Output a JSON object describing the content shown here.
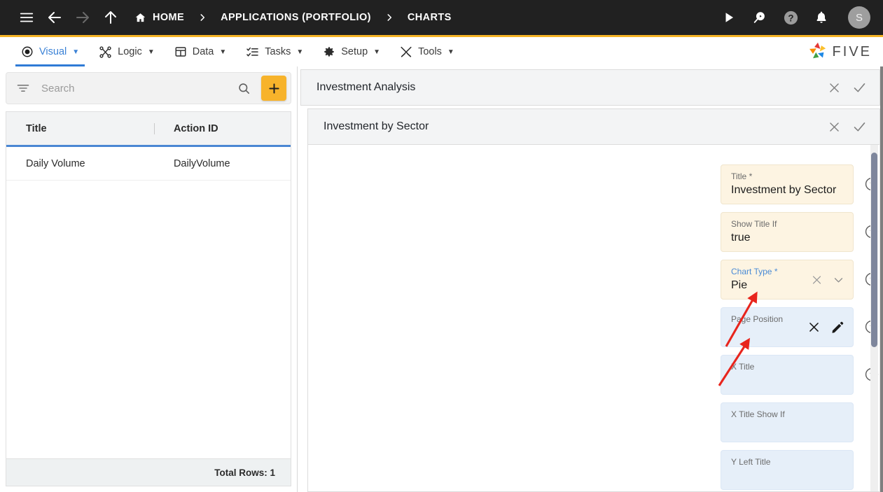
{
  "topbar": {
    "icons": [
      {
        "name": "hamburger-menu-icon",
        "label": "Menu"
      },
      {
        "name": "back-arrow-icon",
        "label": "Back"
      },
      {
        "name": "forward-arrow-icon",
        "label": "Forward"
      },
      {
        "name": "up-arrow-icon",
        "label": "Up"
      }
    ],
    "breadcrumbs": [
      {
        "label": "HOME",
        "icon": "home-icon"
      },
      {
        "label": "APPLICATIONS (PORTFOLIO)",
        "icon": ""
      },
      {
        "label": "CHARTS",
        "icon": ""
      }
    ],
    "separator": "›",
    "right_icons": [
      {
        "name": "play-icon",
        "label": "Run"
      },
      {
        "name": "search-play-icon",
        "label": "Search"
      },
      {
        "name": "help-circle-icon",
        "label": "Help"
      },
      {
        "name": "bell-icon",
        "label": "Notifications"
      }
    ],
    "avatar_initial": "S",
    "background": "#212121"
  },
  "menubar": {
    "accent_top": "#f5b324",
    "active_color": "#3b82d6",
    "caret": "▼",
    "items": [
      {
        "label": "Visual",
        "icon": "eye-icon",
        "active": true
      },
      {
        "label": "Logic",
        "icon": "logic-nodes-icon",
        "active": false
      },
      {
        "label": "Data",
        "icon": "table-grid-icon",
        "active": false
      },
      {
        "label": "Tasks",
        "icon": "checklist-icon",
        "active": false
      },
      {
        "label": "Setup",
        "icon": "gear-icon",
        "active": false
      },
      {
        "label": "Tools",
        "icon": "tools-wrench-icon",
        "active": false
      }
    ],
    "brand": {
      "text": "FIVE",
      "logo": "five-star-logo-icon"
    }
  },
  "sidebar": {
    "search": {
      "placeholder": "Search",
      "value": "",
      "filter_icon": "filter-icon",
      "search_icon": "search-icon"
    },
    "add_button": {
      "label": "+",
      "icon": "plus-icon",
      "color": "#f7b32b"
    },
    "table": {
      "columns": [
        "Title",
        "Action ID"
      ],
      "rows": [
        {
          "title": "Daily Volume",
          "action_id": "DailyVolume"
        }
      ],
      "header_underline": "#4a87d3"
    },
    "footer": {
      "total_rows_label": "Total Rows: 1"
    }
  },
  "main": {
    "outer_card": {
      "title": "Investment Analysis",
      "close_icon": "close-x-icon",
      "confirm_icon": "check-icon"
    },
    "inner_card": {
      "title": "Investment by Sector",
      "close_icon": "close-x-icon",
      "confirm_icon": "check-icon"
    },
    "fields": [
      {
        "label": "Title",
        "required": true,
        "value": "Investment by Sector",
        "state": "filled",
        "label_focused": false,
        "help": true,
        "icons": []
      },
      {
        "label": "Show Title If",
        "required": false,
        "value": "true",
        "state": "filled",
        "label_focused": false,
        "help": true,
        "icons": []
      },
      {
        "label": "Chart Type",
        "required": true,
        "value": "Pie",
        "state": "filled",
        "label_focused": true,
        "help": true,
        "icons": [
          "clear-x-icon",
          "chevron-down-icon"
        ]
      },
      {
        "label": "Page Position",
        "required": false,
        "value": "",
        "state": "empty",
        "label_focused": false,
        "help": true,
        "icons": [
          "clear-x-icon",
          "edit-pencil-icon"
        ]
      },
      {
        "label": "X Title",
        "required": false,
        "value": "",
        "state": "empty",
        "label_focused": false,
        "help": true,
        "icons": []
      },
      {
        "label": "X Title Show If",
        "required": false,
        "value": "",
        "state": "empty",
        "label_focused": false,
        "help": false,
        "icons": []
      },
      {
        "label": "Y Left Title",
        "required": false,
        "value": "",
        "state": "empty",
        "label_focused": false,
        "help": false,
        "icons": []
      }
    ],
    "annotations": [
      {
        "name": "arrow-to-chart-type-dropdown",
        "color": "#e8251d"
      },
      {
        "name": "arrow-to-page-position-edit",
        "color": "#e8251d"
      }
    ]
  },
  "colors": {
    "filled_field_bg": "#fdf4e2",
    "empty_field_bg": "#e6eff9",
    "accent_yellow": "#f5b324",
    "accent_blue": "#3b82d6",
    "topbar_bg": "#212121"
  }
}
